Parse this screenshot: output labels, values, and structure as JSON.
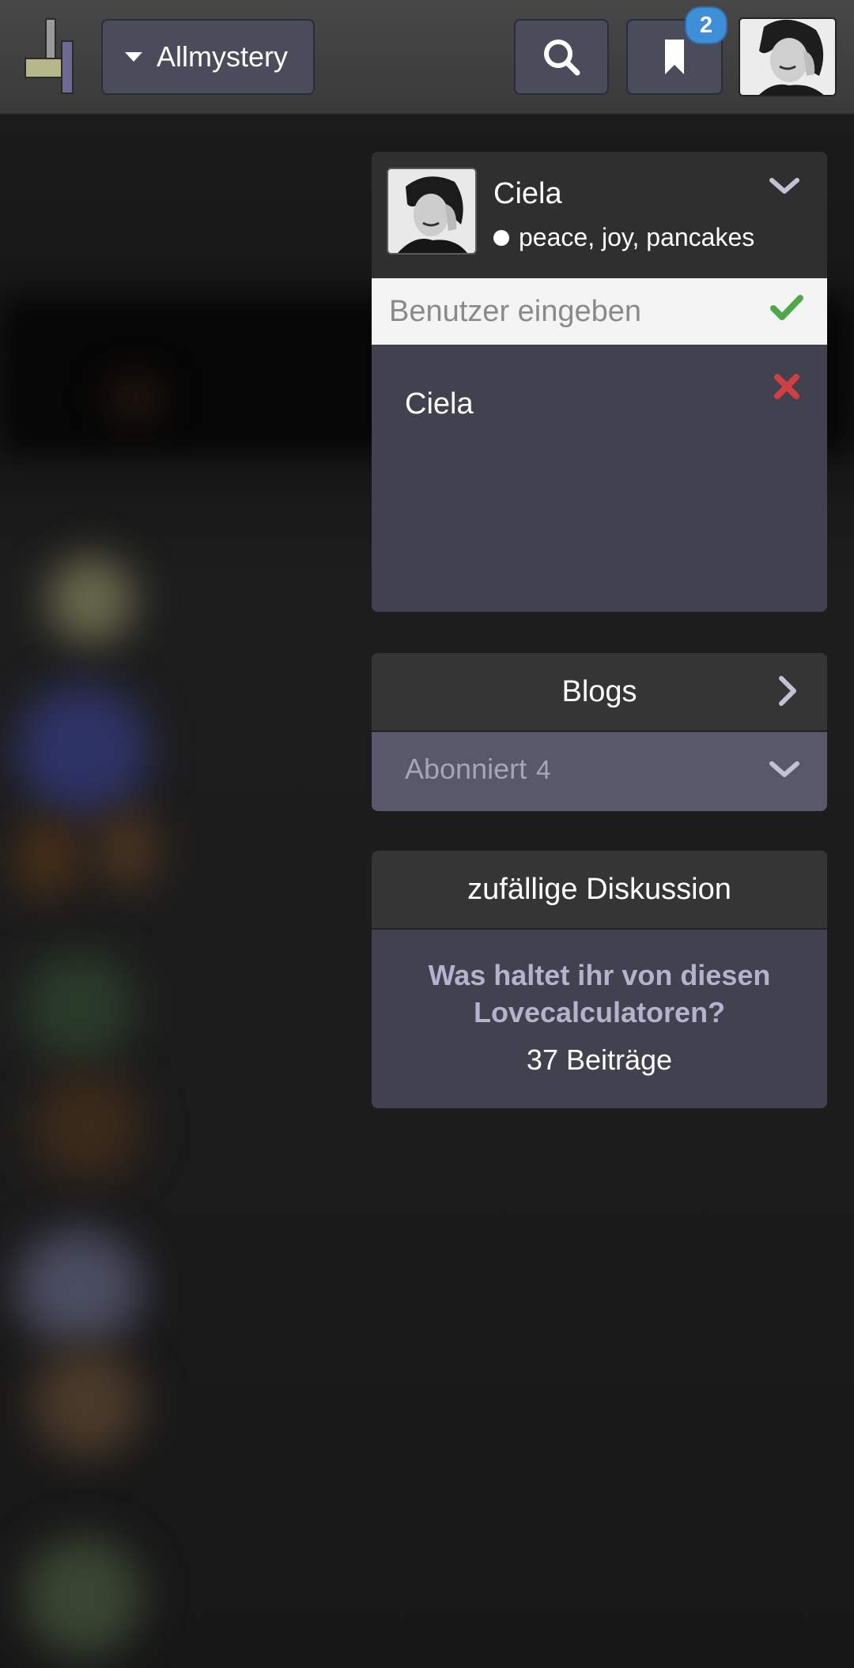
{
  "header": {
    "forum_label": "Allmystery",
    "bookmark_badge": "2"
  },
  "profile": {
    "name": "Ciela",
    "status": "peace, joy, pancakes",
    "user_input_placeholder": "Benutzer eingeben",
    "user_list": [
      "Ciela"
    ]
  },
  "blogs": {
    "title": "Blogs",
    "subscribed_label": "Abonniert",
    "subscribed_count": "4"
  },
  "random_discussion": {
    "title": "zufällige Diskussion",
    "topic": "Was haltet ihr von diesen Lovecalculatoren?",
    "posts": "37 Beiträge"
  },
  "colors": {
    "accent_link": "#b4b2cc",
    "badge": "#3f8fd8",
    "check": "#4ea84a",
    "remove": "#d04040"
  }
}
